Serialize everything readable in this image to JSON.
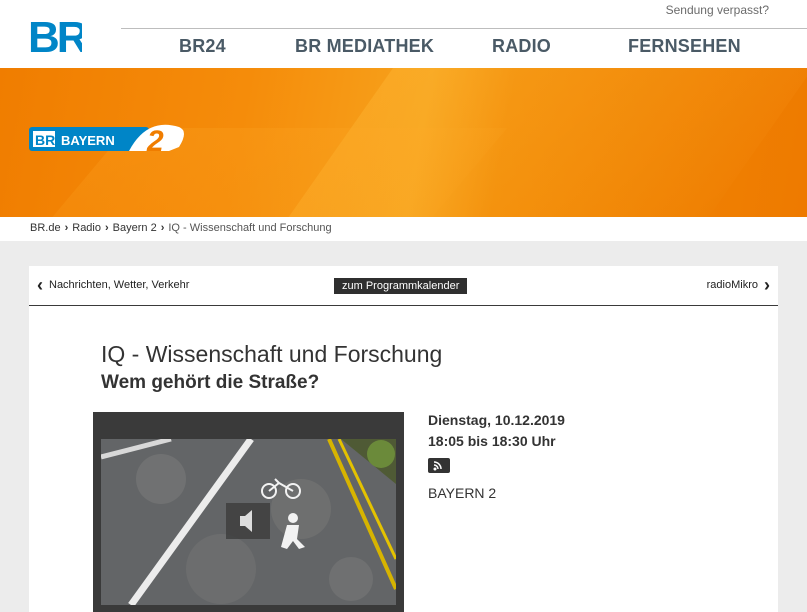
{
  "header": {
    "sendung_link": "Sendung verpasst?",
    "nav": [
      "BR24",
      "BR MEDIATHEK",
      "RADIO",
      "FERNSEHEN"
    ]
  },
  "brand": {
    "accent": "#f07d00",
    "logo_color": "#0085c7"
  },
  "breadcrumb": {
    "items": [
      "BR.de",
      "Radio",
      "Bayern 2"
    ],
    "current": "IQ - Wissenschaft und Forschung"
  },
  "pager": {
    "prev": "Nachrichten, Wetter, Verkehr",
    "calendar": "zum Programmkalender",
    "next": "radioMikro"
  },
  "program": {
    "title": "IQ - Wissenschaft und Forschung",
    "subtitle": "Wem gehört die Straße?",
    "date": "Dienstag, 10.12.2019",
    "time": "18:05 bis 18:30 Uhr",
    "station": "BAYERN 2"
  }
}
